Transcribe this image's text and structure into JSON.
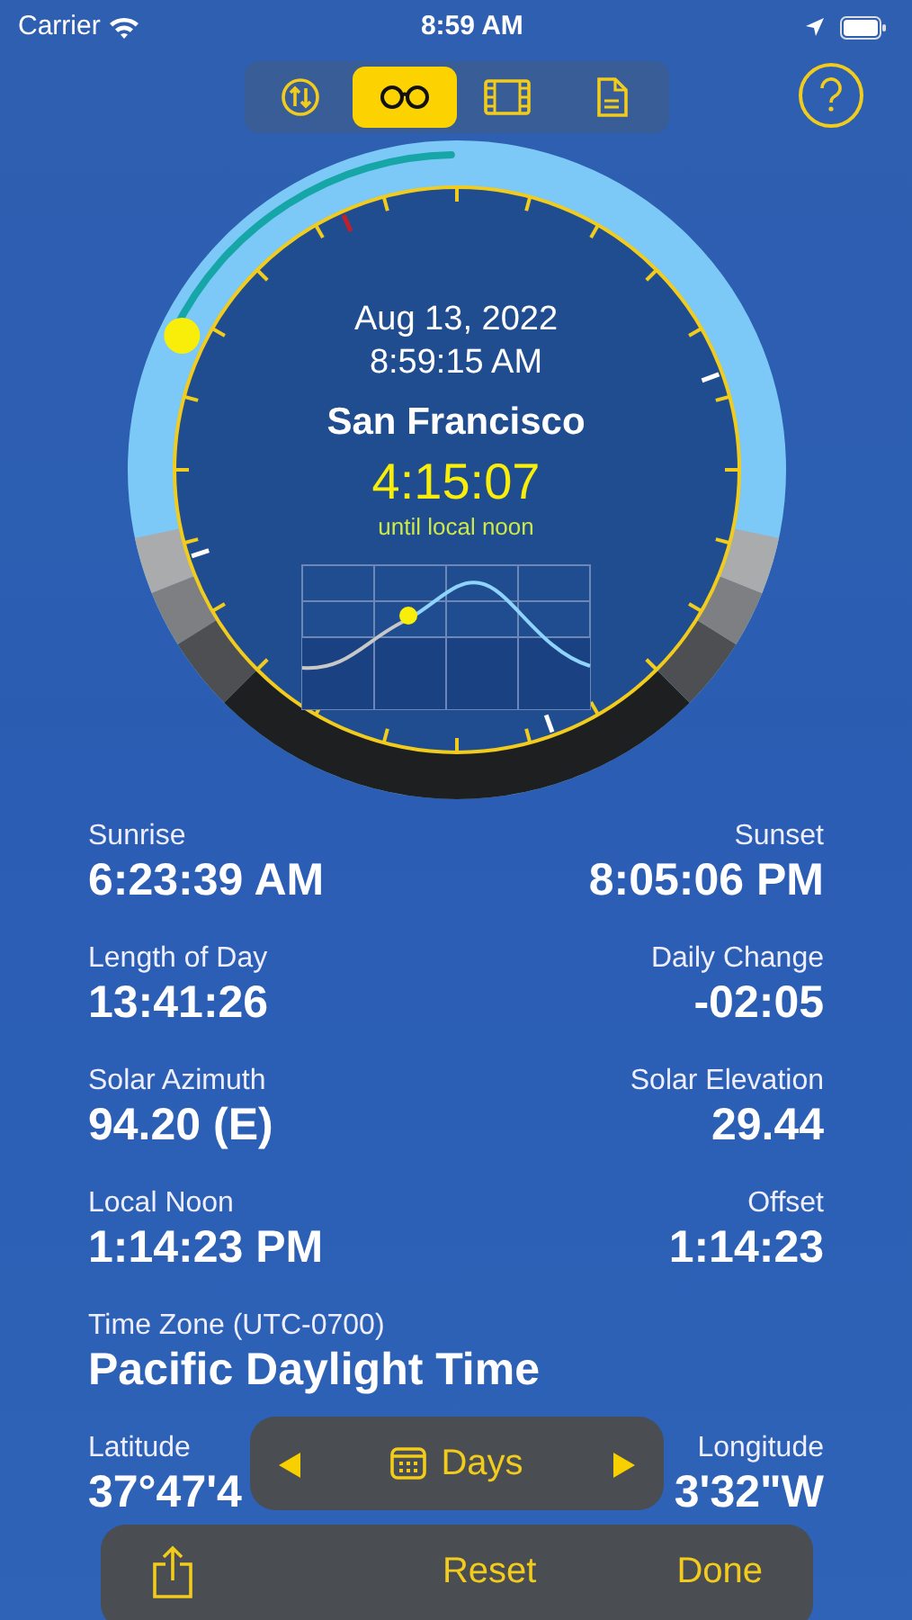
{
  "status_bar": {
    "carrier": "Carrier",
    "time": "8:59 AM"
  },
  "tabs": [
    {
      "kind": "swap",
      "selected": false
    },
    {
      "kind": "glasses",
      "selected": true
    },
    {
      "kind": "film",
      "selected": false
    },
    {
      "kind": "document",
      "selected": false
    }
  ],
  "dial": {
    "date": "Aug 13, 2022",
    "time": "8:59:15 AM",
    "city": "San Francisco",
    "countdown": "4:15:07",
    "countdown_caption": "until local noon"
  },
  "fields": [
    {
      "left": {
        "label": "Sunrise",
        "value": "6:23:39 AM"
      },
      "right": {
        "label": "Sunset",
        "value": "8:05:06 PM"
      }
    },
    {
      "left": {
        "label": "Length of Day",
        "value": "13:41:26"
      },
      "right": {
        "label": "Daily Change",
        "value": "-02:05"
      }
    },
    {
      "left": {
        "label": "Solar Azimuth",
        "value": "94.20 (E)"
      },
      "right": {
        "label": "Solar Elevation",
        "value": "29.44"
      }
    },
    {
      "left": {
        "label": "Local Noon",
        "value": "1:14:23 PM"
      },
      "right": {
        "label": "Offset",
        "value": "1:14:23"
      }
    },
    {
      "left": {
        "label": "Time Zone (UTC-0700)",
        "value": "Pacific Daylight Time"
      }
    },
    {
      "left": {
        "label": "Latitude",
        "value": "37°47'4"
      },
      "right": {
        "label": "Longitude",
        "value": "3'32\"W"
      }
    }
  ],
  "stepper": {
    "label": "Days"
  },
  "bottom_bar": {
    "buttons": [
      "Reset",
      "Done"
    ]
  }
}
